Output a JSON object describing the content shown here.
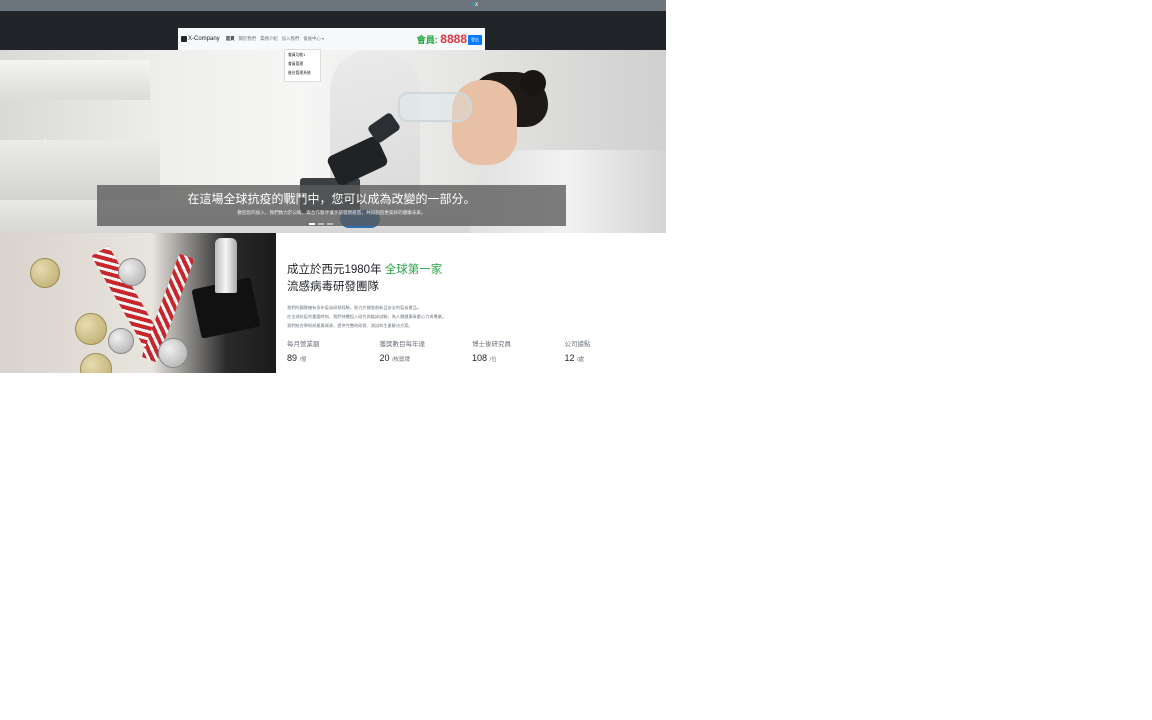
{
  "topbar": {
    "close_label": "x"
  },
  "navbar": {
    "brand": "X-Company",
    "links": [
      {
        "label": "首頁",
        "active": true
      },
      {
        "label": "關於我們",
        "active": false
      },
      {
        "label": "業務介紹",
        "active": false
      },
      {
        "label": "加入我們",
        "active": false
      },
      {
        "label": "會員中心"
      }
    ],
    "member_label": "會員:",
    "member_number": "8888",
    "login_label": "登出"
  },
  "dropdown": {
    "items": [
      "會員功能1",
      "會員管理",
      "後台管理系統"
    ]
  },
  "hero": {
    "prev_label": "‹",
    "title": "在這場全球抗疫的戰鬥中，您可以成為改變的一部分。",
    "subtitle": "歡迎您的加入，我們致力於公衛，與合作夥伴攜手研發新疫苗，共同創造更美好的健康未來。"
  },
  "about": {
    "heading_line1_prefix": "成立於西元1980年",
    "heading_line1_highlight": "全球第一家",
    "heading_line2": "流感病毒研發團隊",
    "paragraphs": [
      "我們的團隊擁有多年疫苗研發經驗，致力於開發創新且安全的疫苗產品。",
      "在全球抗疫的重要時刻，我們持續投入研究與臨床試驗，為人類健康貢獻心力與專業。",
      "我們結合學術與產業資源，提供完整的研發、測試與生產解決方案。"
    ]
  },
  "stats": [
    {
      "label": "每月營業額",
      "value": "89",
      "unit": "/億"
    },
    {
      "label": "獲獎數目每年達",
      "value": "20",
      "unit": "/枚獎牌"
    },
    {
      "label": "博士後研究員",
      "value": "108",
      "unit": "/位"
    },
    {
      "label": "公司據點",
      "value": "12",
      "unit": "/處"
    }
  ],
  "colors": {
    "accent_green": "#28a745",
    "member_red": "#dc3545",
    "primary_blue": "#007bff",
    "header_dark": "#212529"
  }
}
